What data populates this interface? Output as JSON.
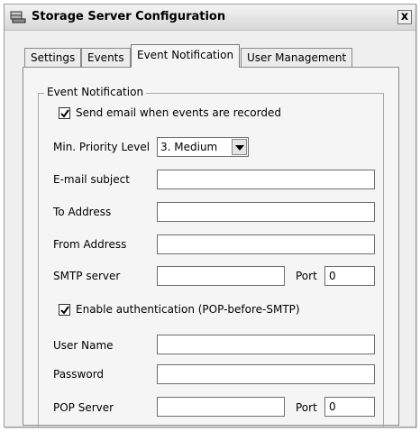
{
  "window": {
    "title": "Storage Server Configuration",
    "close_label": "x"
  },
  "tabs": [
    {
      "label": "Settings"
    },
    {
      "label": "Events"
    },
    {
      "label": "Event Notification"
    },
    {
      "label": "User Management"
    }
  ],
  "group": {
    "legend": "Event Notification"
  },
  "send_email": {
    "label": "Send email when events are recorded",
    "checked": true
  },
  "priority": {
    "label": "Min. Priority Level",
    "selected": "3. Medium"
  },
  "subject": {
    "label": "E-mail subject",
    "value": ""
  },
  "to_address": {
    "label": "To Address",
    "value": ""
  },
  "from_address": {
    "label": "From Address",
    "value": ""
  },
  "smtp": {
    "label": "SMTP server",
    "value": "",
    "port_label": "Port",
    "port_value": "0"
  },
  "auth": {
    "label": "Enable authentication (POP-before-SMTP)",
    "checked": true
  },
  "user_name": {
    "label": "User Name",
    "value": ""
  },
  "password": {
    "label": "Password",
    "value": ""
  },
  "pop": {
    "label": "POP Server",
    "value": "",
    "port_label": "Port",
    "port_value": "0"
  }
}
